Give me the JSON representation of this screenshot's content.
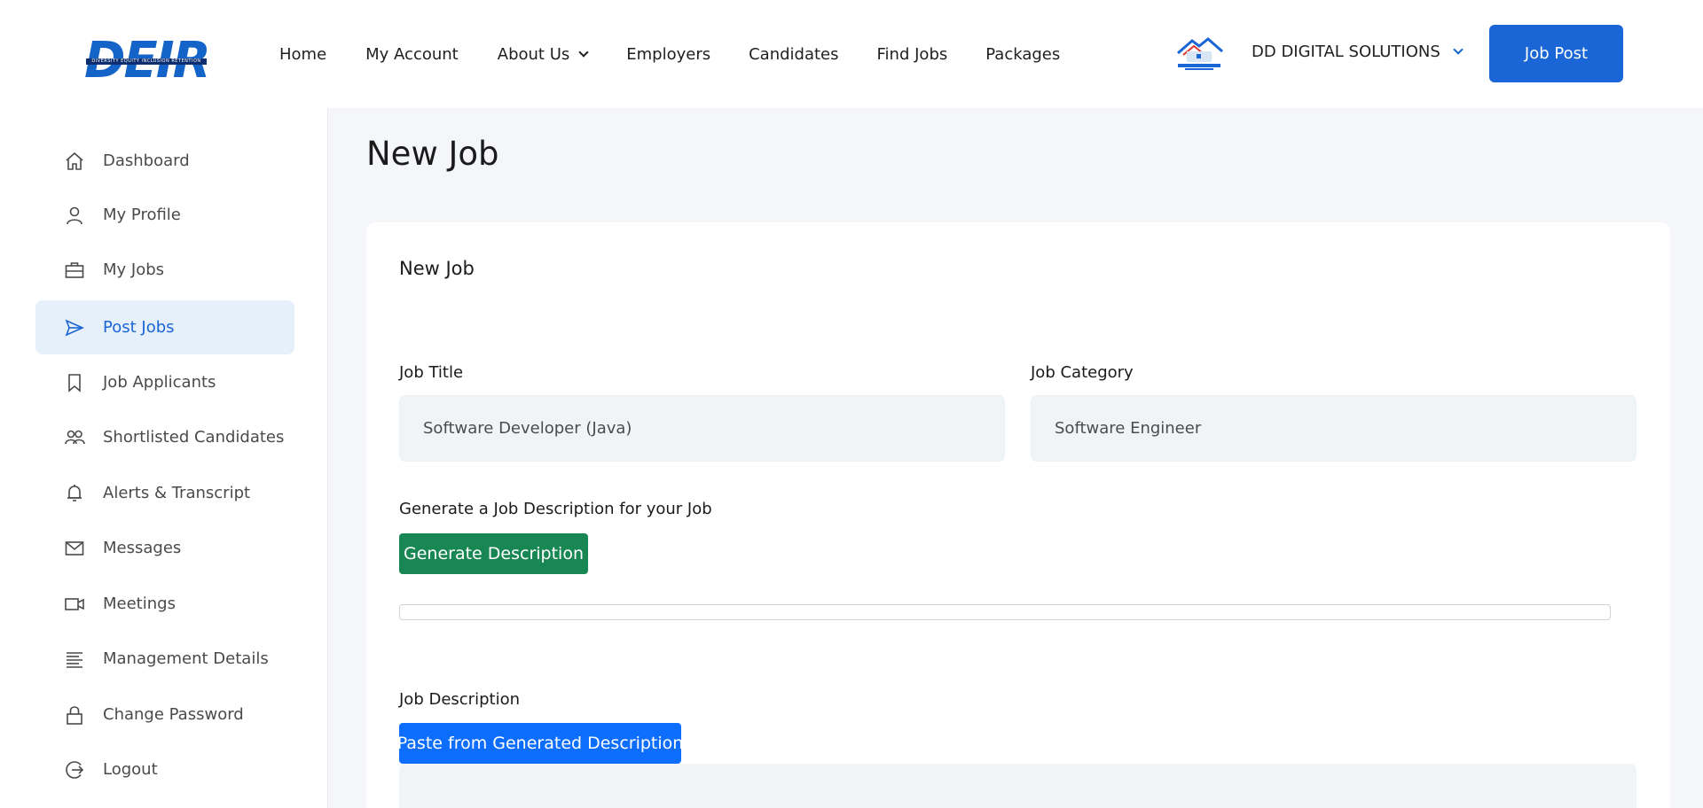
{
  "header": {
    "logo_text": "DEIR",
    "logo_tagline": "DIVERSITY EQUITY INCLUSION RETENTION",
    "nav": [
      {
        "label": "Home",
        "has_dropdown": false
      },
      {
        "label": "My Account",
        "has_dropdown": false
      },
      {
        "label": "About Us",
        "has_dropdown": true
      },
      {
        "label": "Employers",
        "has_dropdown": false
      },
      {
        "label": "Candidates",
        "has_dropdown": false
      },
      {
        "label": "Find Jobs",
        "has_dropdown": false
      },
      {
        "label": "Packages",
        "has_dropdown": false
      }
    ],
    "company_logo_text": "ADVANCE PROPERTY",
    "company_name": "DD DIGITAL SOLUTIONS",
    "job_post_label": "Job Post"
  },
  "sidebar": {
    "items": [
      {
        "label": "Dashboard",
        "icon": "home-icon",
        "active": false
      },
      {
        "label": "My Profile",
        "icon": "user-icon",
        "active": false
      },
      {
        "label": "My Jobs",
        "icon": "briefcase-icon",
        "active": false
      },
      {
        "label": "Post Jobs",
        "icon": "send-icon",
        "active": true
      },
      {
        "label": "Job Applicants",
        "icon": "bookmark-icon",
        "active": false
      },
      {
        "label": "Shortlisted Candidates",
        "icon": "users-icon",
        "active": false
      },
      {
        "label": "Alerts & Transcript",
        "icon": "bell-icon",
        "active": false
      },
      {
        "label": "Messages",
        "icon": "mail-icon",
        "active": false
      },
      {
        "label": "Meetings",
        "icon": "video-icon",
        "active": false
      },
      {
        "label": "Management Details",
        "icon": "list-icon",
        "active": false
      },
      {
        "label": "Change Password",
        "icon": "lock-icon",
        "active": false
      },
      {
        "label": "Logout",
        "icon": "logout-icon",
        "active": false
      }
    ]
  },
  "main": {
    "page_title": "New Job",
    "card_title": "New Job",
    "job_title_label": "Job Title",
    "job_title_value": "Software Developer (Java)",
    "job_category_label": "Job Category",
    "job_category_value": "Software Engineer",
    "generate_label": "Generate a Job Description for your Job",
    "generate_button": "Generate Description",
    "progress_percent": 0,
    "job_description_label": "Job Description",
    "paste_button": "Paste from Generated Description"
  },
  "colors": {
    "primary": "#1a66d6",
    "success": "#198754",
    "accent_blue": "#0d6efd",
    "sidebar_active_bg": "#e6f0fb"
  }
}
